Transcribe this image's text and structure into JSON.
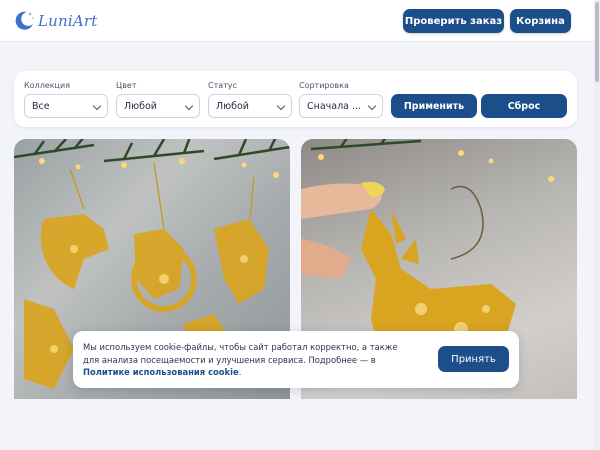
{
  "header": {
    "logo_text": "LuniArt",
    "check_order_label": "Проверить заказ",
    "cart_label": "Корзина"
  },
  "filters": {
    "collection": {
      "label": "Коллекция",
      "value": "Все"
    },
    "color": {
      "label": "Цвет",
      "value": "Любой"
    },
    "status": {
      "label": "Статус",
      "value": "Любой"
    },
    "sort": {
      "label": "Сортировка",
      "value": "Сначала ..."
    },
    "apply_label": "Применить",
    "reset_label": "Сброс"
  },
  "products": [
    {
      "image": "gold-resin-ornaments-flatlay"
    },
    {
      "image": "gold-resin-goat-ornament-in-hand"
    }
  ],
  "cookie": {
    "text": "Мы используем cookie-файлы, чтобы сайт работал корректно, а также для анализа посещаемости и улучшения сервиса. Подробнее — в ",
    "link": "Политике использования cookie",
    "end": ".",
    "accept_label": "Принять"
  },
  "colors": {
    "primary": "#1c4f8a",
    "background": "#f3f4f9",
    "logo": "#3a73c9",
    "gold": "#d9a520"
  },
  "icons": [
    "moon-logo-icon",
    "chevron-down-icon"
  ]
}
